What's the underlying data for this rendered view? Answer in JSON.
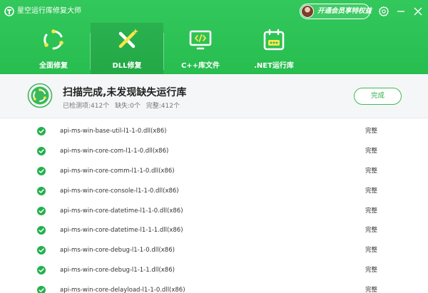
{
  "app": {
    "title": "星空运行库修复大师"
  },
  "header": {
    "vip_label": "开通会员享特权益",
    "tabs": [
      {
        "label": "全面修复",
        "icon": "recycle-icon",
        "active": false
      },
      {
        "label": "DLL修复",
        "icon": "tools-icon",
        "active": true
      },
      {
        "label": "C++库文件",
        "icon": "code-monitor-icon",
        "active": false
      },
      {
        "label": ".NET运行库",
        "icon": "net-calendar-icon",
        "active": false
      }
    ]
  },
  "status": {
    "title": "扫描完成,未发现缺失运行库",
    "detected_label": "已检测项:412个",
    "missing_label": "缺失:0个",
    "complete_label": "完整:412个",
    "done_button": "完成"
  },
  "list": {
    "items": [
      {
        "name": "api-ms-win-base-util-l1-1-0.dll(x86)",
        "status": "完整"
      },
      {
        "name": "api-ms-win-core-com-l1-1-0.dll(x86)",
        "status": "完整"
      },
      {
        "name": "api-ms-win-core-comm-l1-1-0.dll(x86)",
        "status": "完整"
      },
      {
        "name": "api-ms-win-core-console-l1-1-0.dll(x86)",
        "status": "完整"
      },
      {
        "name": "api-ms-win-core-datetime-l1-1-0.dll(x86)",
        "status": "完整"
      },
      {
        "name": "api-ms-win-core-datetime-l1-1-1.dll(x86)",
        "status": "完整"
      },
      {
        "name": "api-ms-win-core-debug-l1-1-0.dll(x86)",
        "status": "完整"
      },
      {
        "name": "api-ms-win-core-debug-l1-1-1.dll(x86)",
        "status": "完整"
      },
      {
        "name": "api-ms-win-core-delayload-l1-1-0.dll(x86)",
        "status": "完整"
      }
    ]
  },
  "colors": {
    "brand_green": "#27bd4f",
    "check_green": "#22b14c"
  }
}
